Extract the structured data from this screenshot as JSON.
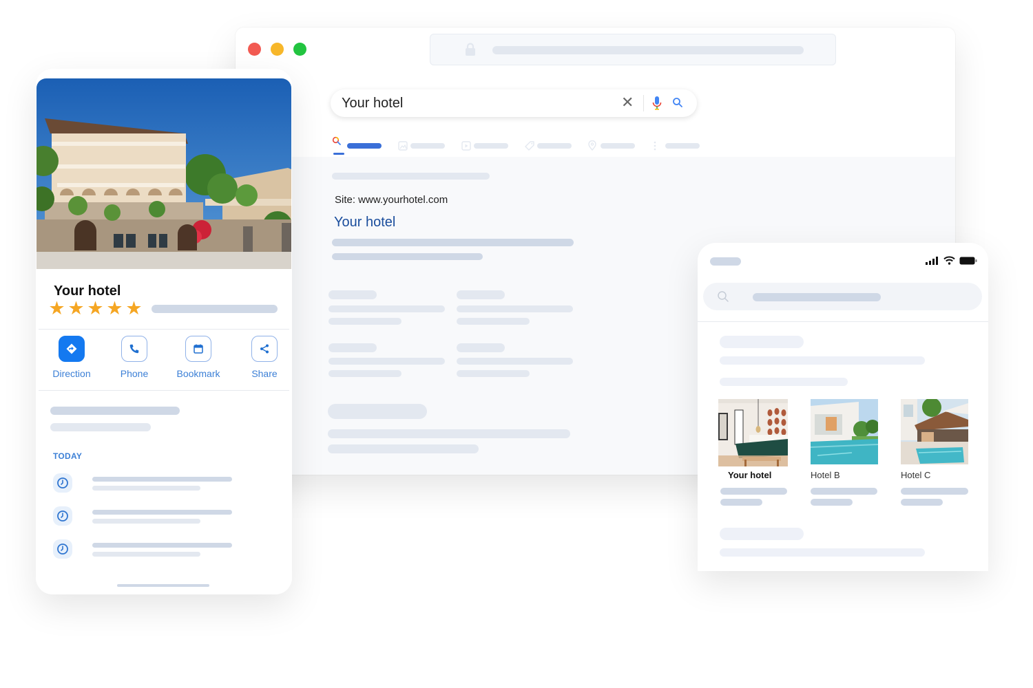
{
  "browser": {
    "window_controls": [
      "close",
      "minimize",
      "maximize"
    ],
    "address_icon": "lock-icon",
    "search": {
      "query": "Your hotel",
      "clear_icon": "✕",
      "mic_icon": "mic-icon",
      "search_icon": "search-icon"
    },
    "tabs": [
      {
        "icon": "search-icon",
        "active": true
      },
      {
        "icon": "image-icon",
        "active": false
      },
      {
        "icon": "video-icon",
        "active": false
      },
      {
        "icon": "tag-icon",
        "active": false
      },
      {
        "icon": "map-pin-icon",
        "active": false
      },
      {
        "icon": "more-icon",
        "active": false
      }
    ],
    "result": {
      "site": "Site: www.yourhotel.com",
      "title": "Your hotel"
    }
  },
  "business_card": {
    "name": "Your hotel",
    "rating_stars": 5,
    "rating_max": 5,
    "actions": [
      {
        "label": "Direction",
        "icon": "direction-icon"
      },
      {
        "label": "Phone",
        "icon": "phone-icon"
      },
      {
        "label": "Bookmark",
        "icon": "calendar-icon"
      },
      {
        "label": "Share",
        "icon": "share-icon"
      }
    ],
    "section_label": "TODAY",
    "schedule_items": 3
  },
  "mobile_results": {
    "status_icons": [
      "signal-icon",
      "wifi-icon",
      "battery-icon"
    ],
    "search_icon": "search-icon",
    "hotels": [
      {
        "name": "Your hotel",
        "highlight": true
      },
      {
        "name": "Hotel B",
        "highlight": false
      },
      {
        "name": "Hotel C",
        "highlight": false
      }
    ]
  },
  "colors": {
    "accent_blue": "#1479f0",
    "link_blue": "#1a4d9c",
    "tab_active": "#3a6fd8",
    "star": "#f5a623",
    "skeleton": "#cfd8e6"
  }
}
